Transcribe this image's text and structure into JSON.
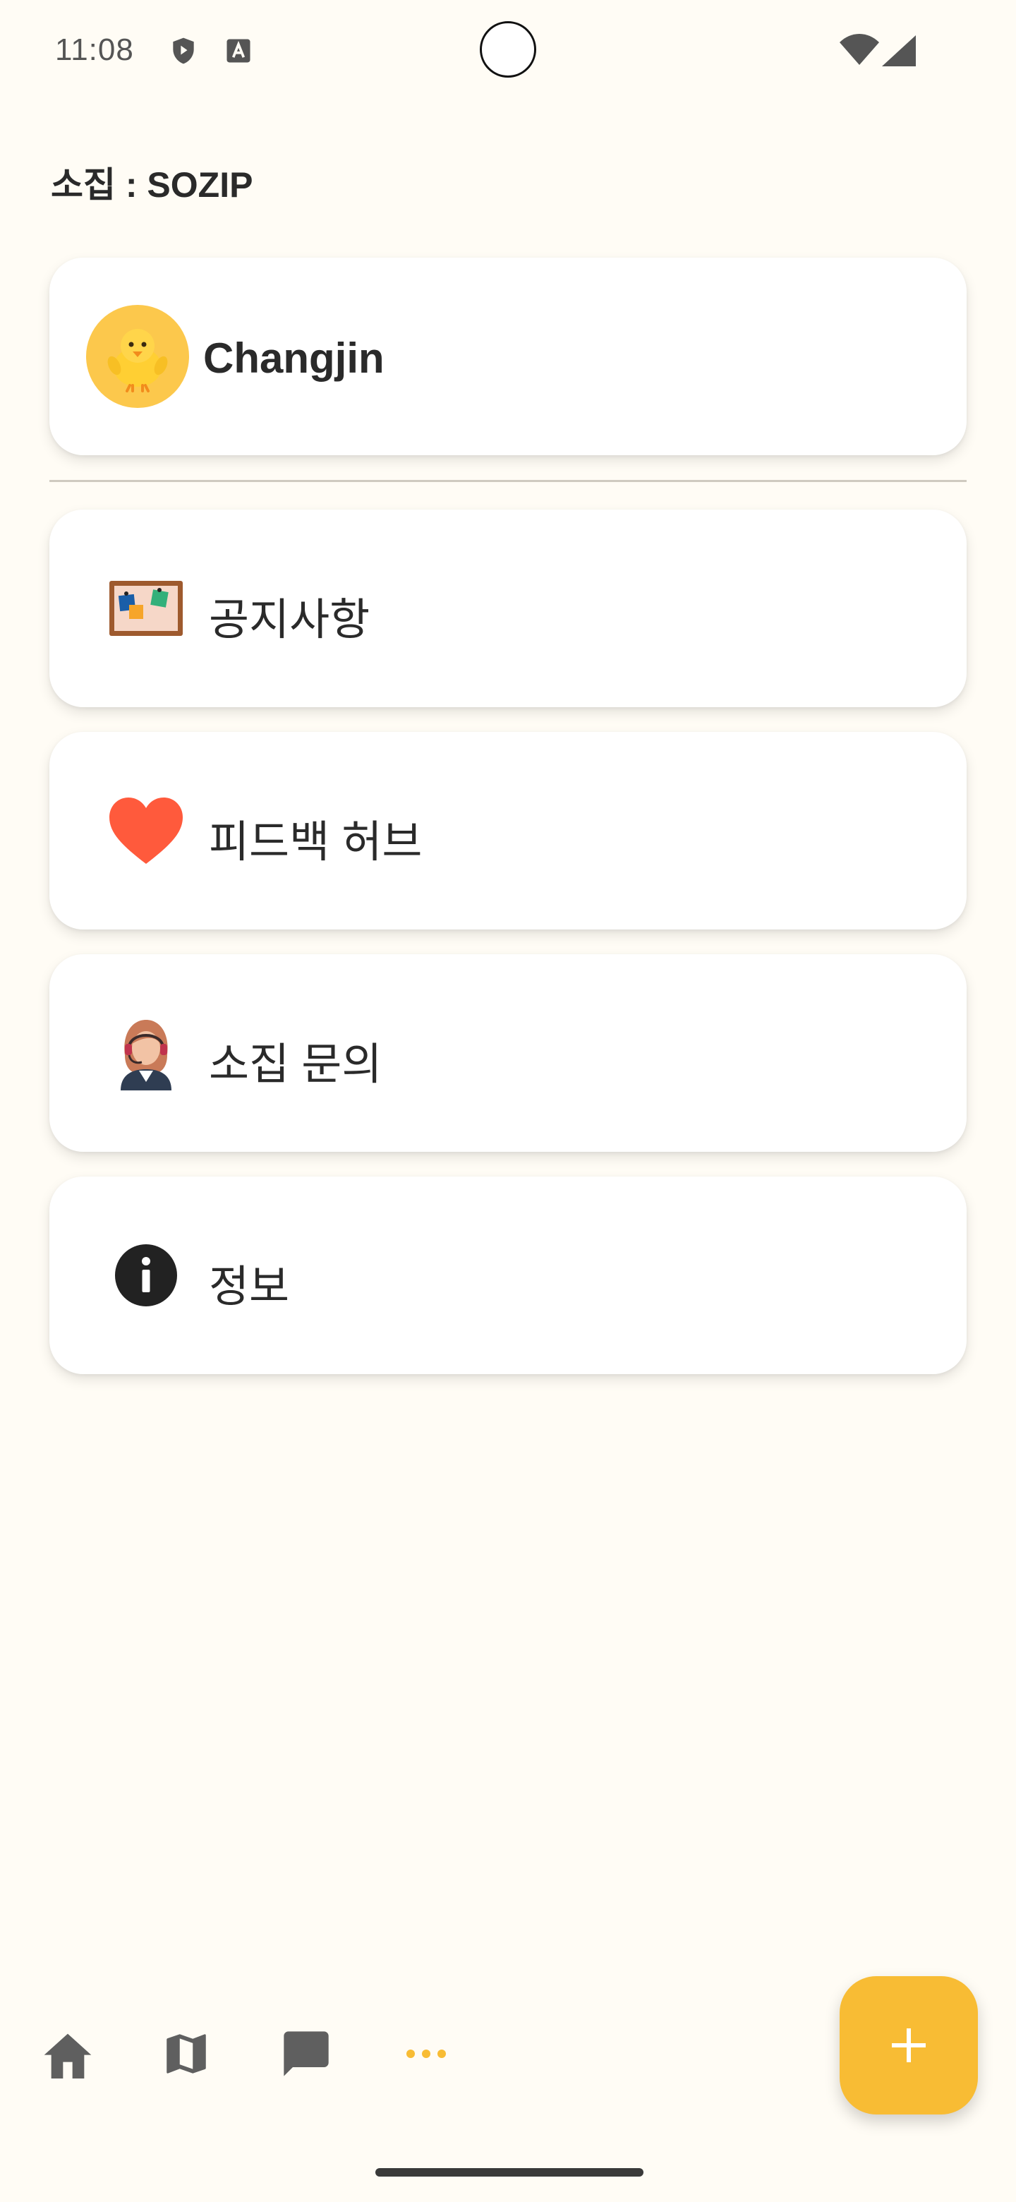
{
  "status_bar": {
    "time": "11:08",
    "icons": [
      "shield-play-icon",
      "font-a-icon",
      "wifi-icon",
      "cellular-signal-icon"
    ]
  },
  "header": {
    "title": "소집 : SOZIP"
  },
  "profile": {
    "name": "Changjin",
    "avatar_emoji": "🐥"
  },
  "menu": {
    "items": [
      {
        "label": "공지사항",
        "icon": "bulletin-board-icon"
      },
      {
        "label": "피드백 허브",
        "icon": "heart-icon"
      },
      {
        "label": "소집 문의",
        "icon": "support-agent-icon"
      },
      {
        "label": "정보",
        "icon": "info-icon"
      }
    ]
  },
  "bottom_nav": {
    "items": [
      "home-icon",
      "map-icon",
      "chat-icon",
      "more-icon"
    ],
    "active": "more-icon"
  },
  "fab": {
    "icon": "plus-icon"
  },
  "colors": {
    "background": "#fffcf5",
    "accent": "#f8bc34",
    "heart": "#ff5a3c",
    "nav_icon": "#5f5f5f"
  }
}
